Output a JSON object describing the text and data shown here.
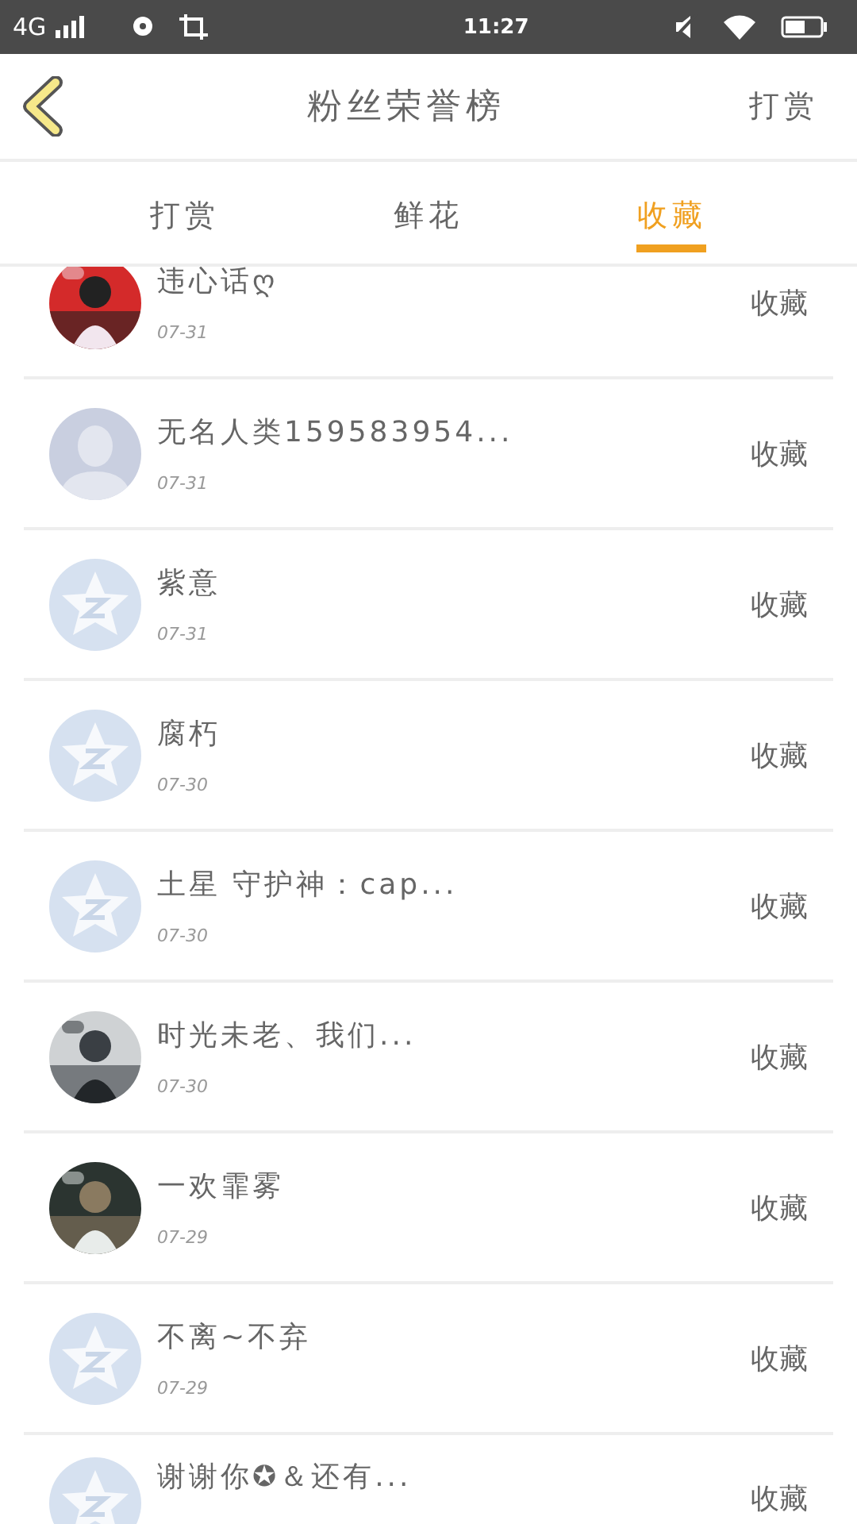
{
  "status_bar": {
    "network": "4G",
    "time": "11:27"
  },
  "header": {
    "title": "粉丝荣誉榜",
    "action": "打赏"
  },
  "tabs": [
    {
      "label": "打赏",
      "selected": false
    },
    {
      "label": "鲜花",
      "selected": false
    },
    {
      "label": "收藏",
      "selected": true
    }
  ],
  "rows": [
    {
      "kind": "picture",
      "name": "违心话ღ",
      "date": "07-31",
      "action": "收藏"
    },
    {
      "kind": "person",
      "name": "无名人类159583954...",
      "date": "07-31",
      "action": "收藏"
    },
    {
      "kind": "star",
      "name": "紫意",
      "date": "07-31",
      "action": "收藏"
    },
    {
      "kind": "star",
      "name": "腐朽",
      "date": "07-30",
      "action": "收藏"
    },
    {
      "kind": "star",
      "name": "土星 守护神：cap...",
      "date": "07-30",
      "action": "收藏"
    },
    {
      "kind": "picture",
      "name": "时光未老、我们...",
      "date": "07-30",
      "action": "收藏"
    },
    {
      "kind": "picture",
      "name": "一欢霏雾",
      "date": "07-29",
      "action": "收藏"
    },
    {
      "kind": "star",
      "name": "不离~不弃",
      "date": "07-29",
      "action": "收藏"
    },
    {
      "kind": "star",
      "name": "谢谢你✪＆还有...",
      "action": "收藏"
    }
  ]
}
